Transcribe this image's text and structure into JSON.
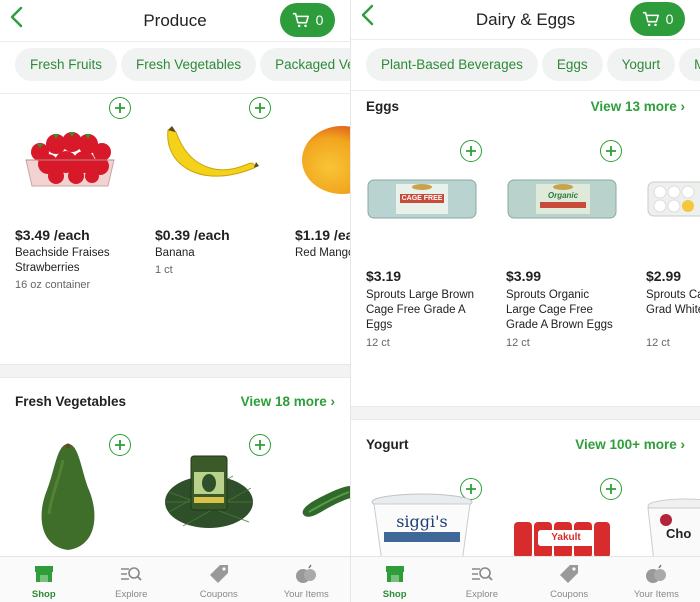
{
  "colors": {
    "accent": "#2e9e3a",
    "chip_bg": "#f1f3f2"
  },
  "left": {
    "title": "Produce",
    "cart_count": "0",
    "chips": [
      "Fresh Fruits",
      "Fresh Vegetables",
      "Packaged Vege"
    ],
    "products": [
      {
        "price": "$3.49 /each",
        "name": "Beachside Fraises Strawberries",
        "size": "16 oz container",
        "image": "strawberries"
      },
      {
        "price": "$0.39 /each",
        "name": "Banana",
        "size": "1 ct",
        "image": "banana"
      },
      {
        "price": "$1.19 /ea",
        "name": "Red Mango",
        "size": "",
        "image": "mango"
      }
    ],
    "section2": {
      "title": "Fresh Vegetables",
      "view_more": "View 18 more",
      "images": [
        "avocado",
        "bagged-avocados",
        "cucumber"
      ]
    }
  },
  "right": {
    "title": "Dairy & Eggs",
    "cart_count": "0",
    "chips": [
      "Plant-Based Beverages",
      "Eggs",
      "Yogurt",
      "Mi"
    ],
    "section1": {
      "title": "Eggs",
      "view_more": "View 13 more",
      "products": [
        {
          "price": "$3.19",
          "name": "Sprouts Large Brown Cage Free Grade A Eggs",
          "size": "12 ct",
          "image": "egg-carton-cage-free",
          "carton_text": "CAGE FREE"
        },
        {
          "price": "$3.99",
          "name": "Sprouts Organic Large Cage Free Grade A Brown Eggs",
          "size": "12 ct",
          "image": "egg-carton-organic",
          "carton_text": "Organic"
        },
        {
          "price": "$2.99",
          "name": "Sprouts Ca Large Grad White Egg",
          "size": "12 ct",
          "image": "egg-carton-white"
        }
      ]
    },
    "section2": {
      "title": "Yogurt",
      "view_more": "View 100+ more",
      "images": [
        "siggis-yogurt",
        "yakult-bottles",
        "chobani-yogurt"
      ],
      "brand_texts": [
        "siggi's",
        "Yakult",
        "Cho"
      ]
    }
  },
  "tabbar": [
    "Shop",
    "Explore",
    "Coupons",
    "Your Items"
  ],
  "icons": {
    "back": "chevron-left-icon",
    "cart": "cart-icon",
    "add": "plus-icon",
    "more": "chevron-right-icon"
  }
}
